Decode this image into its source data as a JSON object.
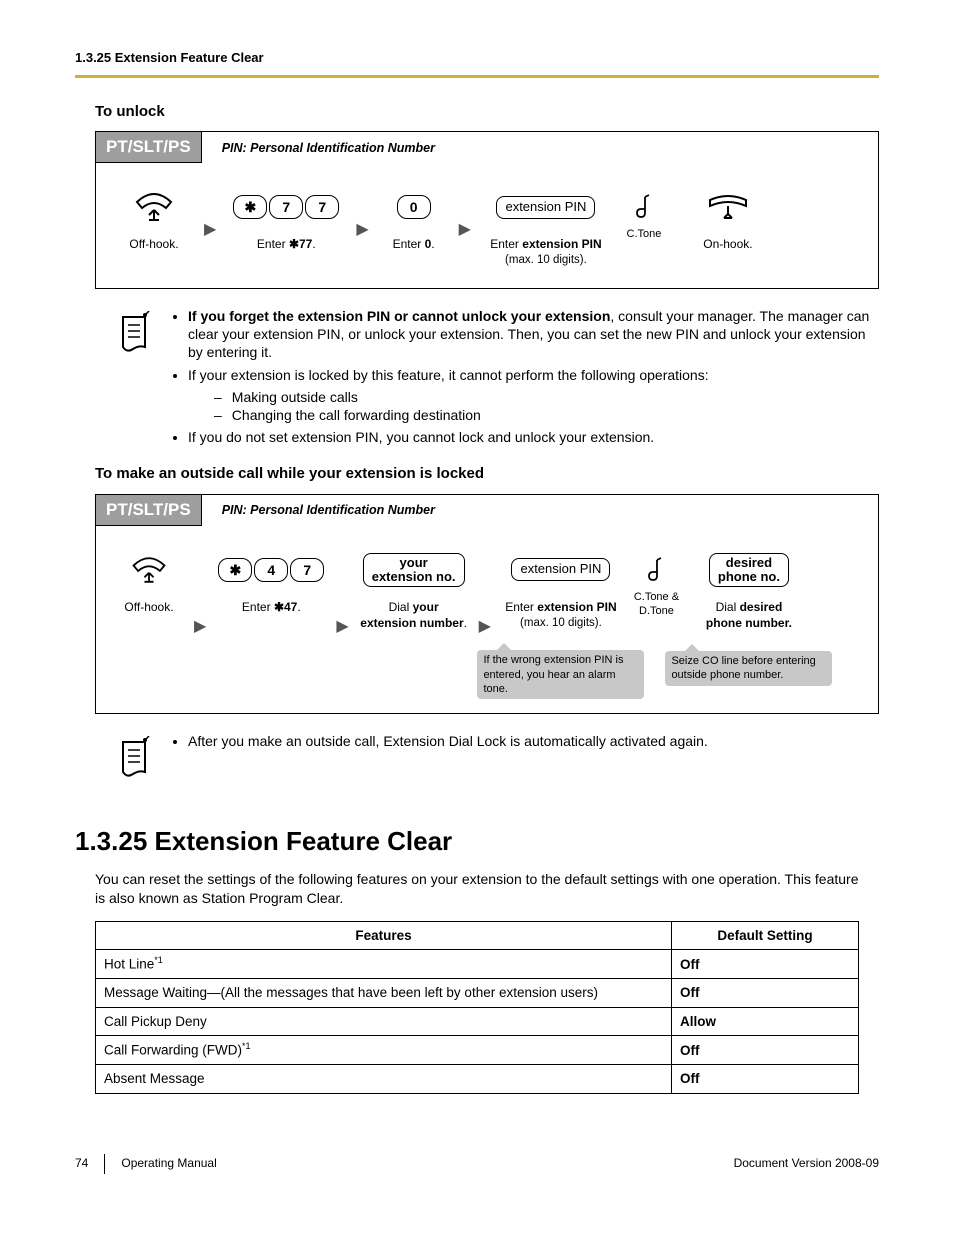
{
  "header": {
    "title": "1.3.25 Extension Feature Clear"
  },
  "unlock": {
    "heading": "To unlock",
    "tag": "PT/SLT/PS",
    "pin_note": "PIN: Personal Identification Number",
    "step1": "Off-hook.",
    "step2_pre": "Enter ",
    "step2_code": "✱77",
    "step3_pre": "Enter ",
    "step3_code": "0",
    "step4_pre": "Enter ",
    "step4_bold": "extension PIN",
    "step4_sub": "(max. 10 digits).",
    "ext_pin_box": "extension PIN",
    "ctone": "C.Tone",
    "step5": "On-hook."
  },
  "notes1": {
    "b1_bold": "If you forget the extension PIN or cannot unlock your extension",
    "b1_rest": ", consult your manager. The manager can clear your extension PIN, or unlock your extension. Then, you can set the new PIN and unlock your extension by entering it.",
    "b2": "If your extension is locked by this feature, it cannot perform the following operations:",
    "b2a": "Making outside calls",
    "b2b": "Changing the call forwarding destination",
    "b3": "If you do not set extension PIN, you cannot lock and unlock your extension."
  },
  "outcall": {
    "heading": "To make an outside call while your extension is locked",
    "tag": "PT/SLT/PS",
    "pin_note": "PIN: Personal Identification Number",
    "step1": "Off-hook.",
    "step2_pre": "Enter ",
    "step2_code": "✱47",
    "ext_box_l1": "your",
    "ext_box_l2": "extension no.",
    "step3_pre": "Dial ",
    "step3_bold": "your",
    "step3_line2": "extension number",
    "pin_box": "extension PIN",
    "step4_pre": "Enter ",
    "step4_bold": "extension PIN",
    "step4_sub": "(max. 10 digits).",
    "ctone": "C.Tone & D.Tone",
    "desired_l1": "desired",
    "desired_l2": "phone no.",
    "step5_pre": "Dial ",
    "step5_bold": "desired",
    "step5_line2": "phone number.",
    "callout1": "If the wrong extension PIN is entered, you hear an alarm tone.",
    "callout2": "Seize CO line before entering outside phone number."
  },
  "notes2": {
    "b1": "After you make an outside call, Extension Dial Lock is automatically activated again."
  },
  "section": {
    "title": "1.3.25  Extension Feature Clear",
    "intro": "You can reset the settings of the following features on your extension to the default settings with one operation. This feature is also known as Station Program Clear."
  },
  "table": {
    "h1": "Features",
    "h2": "Default Setting",
    "rows": [
      {
        "f": "Hot Line",
        "sup": "*1",
        "d": "Off"
      },
      {
        "f": "Message Waiting—(All the messages that have been left by other extension users)",
        "sup": "",
        "d": "Off"
      },
      {
        "f": "Call Pickup Deny",
        "sup": "",
        "d": "Allow"
      },
      {
        "f": "Call Forwarding (FWD)",
        "sup": "*1",
        "d": "Off"
      },
      {
        "f": "Absent Message",
        "sup": "",
        "d": "Off"
      }
    ]
  },
  "footer": {
    "page": "74",
    "manual": "Operating Manual",
    "version": "Document Version  2008-09"
  }
}
